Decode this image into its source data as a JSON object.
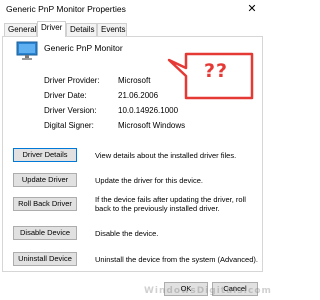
{
  "window": {
    "title": "Generic PnP Monitor Properties",
    "close_glyph": "✕"
  },
  "tabs": [
    {
      "label": "General",
      "active": false
    },
    {
      "label": "Driver",
      "active": true
    },
    {
      "label": "Details",
      "active": false
    },
    {
      "label": "Events",
      "active": false
    }
  ],
  "device": {
    "name": "Generic PnP Monitor",
    "icon": "monitor-icon"
  },
  "callout": {
    "text": "??",
    "color": "#e53935"
  },
  "properties": [
    {
      "label": "Driver Provider:",
      "value": "Microsoft"
    },
    {
      "label": "Driver Date:",
      "value": "21.06.2006"
    },
    {
      "label": "Driver Version:",
      "value": "10.0.14926.1000"
    },
    {
      "label": "Digital Signer:",
      "value": "Microsoft Windows"
    }
  ],
  "actions": [
    {
      "label": "Driver Details",
      "description": "View details about the installed driver files."
    },
    {
      "label": "Update Driver",
      "description": "Update the driver for this device."
    },
    {
      "label": "Roll Back Driver",
      "description": "If the device fails after updating the driver, roll back to the previously installed driver."
    },
    {
      "label": "Disable Device",
      "description": "Disable the device."
    },
    {
      "label": "Uninstall Device",
      "description": "Uninstall the device from the system (Advanced)."
    }
  ],
  "footer": {
    "ok_label": "OK",
    "cancel_label": "Cancel"
  },
  "watermark": "WindowsDigitals.com",
  "colors": {
    "accent": "#0078d7",
    "button_face": "#e1e1e1",
    "button_border": "#adadad",
    "monitor_blue": "#2a84d2"
  }
}
